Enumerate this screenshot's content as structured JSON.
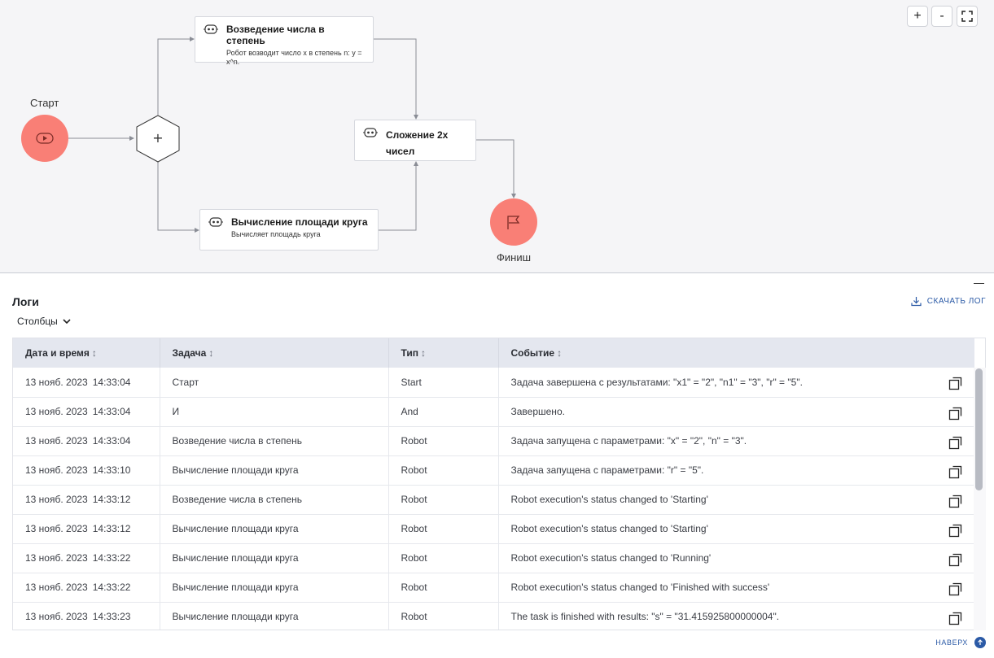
{
  "zoom": {
    "in_label": "+",
    "out_label": "-"
  },
  "diagram": {
    "start_label": "Старт",
    "finish_label": "Финиш",
    "gateway_symbol": "+",
    "tasks": [
      {
        "title": "Возведение числа в степень",
        "desc": "Робот возводит число x в степень n: y = x^n."
      },
      {
        "title": "Сложение 2х чисел",
        "desc": ""
      },
      {
        "title": "Вычисление площади круга",
        "desc": "Вычисляет площадь круга"
      }
    ]
  },
  "logs": {
    "title": "Логи",
    "columns_dropdown": "Столбцы",
    "download_label": "СКАЧАТЬ ЛОГ",
    "headers": [
      "Дата и время",
      "Задача",
      "Тип",
      "Событие"
    ],
    "sort_glyph": "↕",
    "rows": [
      {
        "date": "13 нояб. 2023",
        "time": "14:33:04",
        "task": "Старт",
        "type": "Start",
        "event": "Задача завершена с результатами: \"x1\" = \"2\", \"n1\" = \"3\", \"r\" = \"5\"."
      },
      {
        "date": "13 нояб. 2023",
        "time": "14:33:04",
        "task": "И",
        "type": "And",
        "event": "Завершено."
      },
      {
        "date": "13 нояб. 2023",
        "time": "14:33:04",
        "task": "Возведение числа в степень",
        "type": "Robot",
        "event": "Задача запущена с параметрами: \"x\" = \"2\", \"n\" = \"3\"."
      },
      {
        "date": "13 нояб. 2023",
        "time": "14:33:10",
        "task": "Вычисление площади круга",
        "type": "Robot",
        "event": "Задача запущена с параметрами: \"r\" = \"5\"."
      },
      {
        "date": "13 нояб. 2023",
        "time": "14:33:12",
        "task": "Возведение числа в степень",
        "type": "Robot",
        "event": "Robot execution's status changed to 'Starting'"
      },
      {
        "date": "13 нояб. 2023",
        "time": "14:33:12",
        "task": "Вычисление площади круга",
        "type": "Robot",
        "event": "Robot execution's status changed to 'Starting'"
      },
      {
        "date": "13 нояб. 2023",
        "time": "14:33:22",
        "task": "Вычисление площади круга",
        "type": "Robot",
        "event": "Robot execution's status changed to 'Running'"
      },
      {
        "date": "13 нояб. 2023",
        "time": "14:33:22",
        "task": "Вычисление площади круга",
        "type": "Robot",
        "event": "Robot execution's status changed to 'Finished with success'"
      },
      {
        "date": "13 нояб. 2023",
        "time": "14:33:23",
        "task": "Вычисление площади круга",
        "type": "Robot",
        "event": "The task is finished with results: \"s\" = \"31.415925800000004\"."
      },
      {
        "date": "",
        "time": "",
        "task": "",
        "type": "",
        "event": ""
      }
    ],
    "to_top_label": "НАВЕРХ"
  },
  "colors": {
    "accent": "#2b5aa6",
    "node": "#f97f76",
    "header_bg": "#e4e7ef"
  }
}
